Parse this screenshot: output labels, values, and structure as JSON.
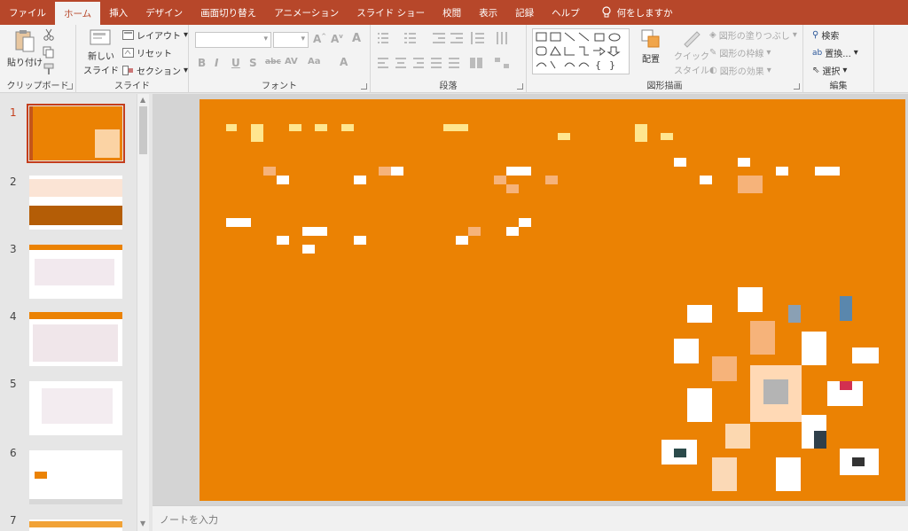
{
  "tabs": [
    "ファイル",
    "ホーム",
    "挿入",
    "デザイン",
    "画面切り替え",
    "アニメーション",
    "スライド ショー",
    "校閲",
    "表示",
    "記録",
    "ヘルプ"
  ],
  "active_tab": "ホーム",
  "tell_me": "何をしますか",
  "colors": {
    "accent": "#b7472a",
    "slide_bg": "#eb8203",
    "selected": "#c43e1c"
  },
  "ribbon": {
    "clipboard": {
      "label": "クリップボード",
      "paste": "貼り付け"
    },
    "slides": {
      "label": "スライド",
      "new_slide": "新しい",
      "new_slide_2": "スライド",
      "layout": "レイアウト",
      "reset": "リセット",
      "section": "セクション"
    },
    "font": {
      "label": "フォント"
    },
    "paragraph": {
      "label": "段落"
    },
    "drawing": {
      "label": "図形描画",
      "arrange": "配置",
      "quick_style_1": "クイック",
      "quick_style_2": "スタイル",
      "fill": "図形の塗りつぶし",
      "outline": "図形の枠線",
      "effect": "図形の効果"
    },
    "editing": {
      "label": "編集",
      "find": "検索",
      "replace": "置換...",
      "select": "選択"
    }
  },
  "slides": [
    1,
    2,
    3,
    4,
    5,
    6,
    7
  ],
  "selected_slide": 1,
  "notes_placeholder": "ノートを入力"
}
